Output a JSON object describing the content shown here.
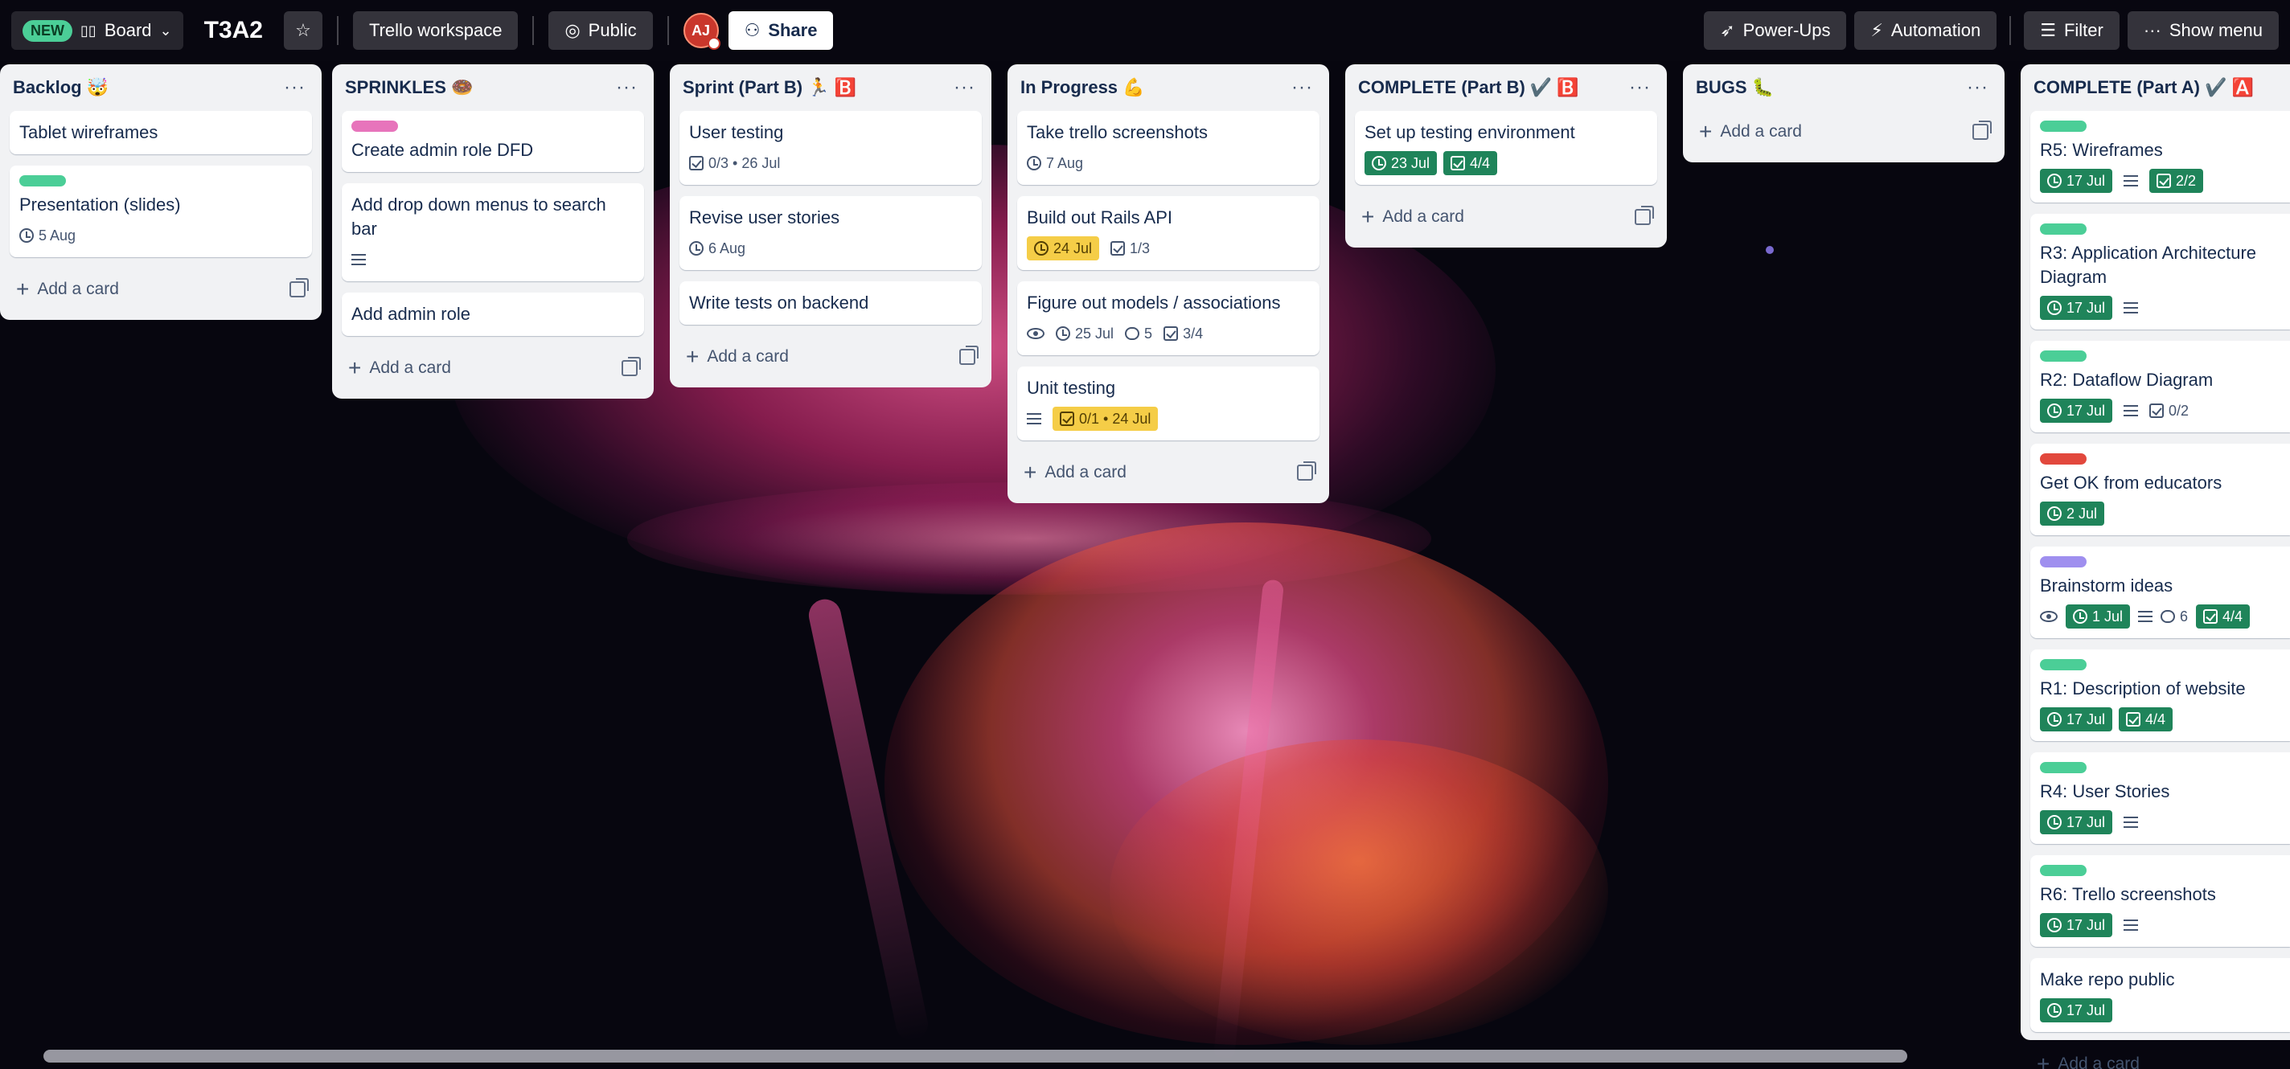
{
  "header": {
    "new_badge": "NEW",
    "board_view": "Board",
    "board_title": "T3A2",
    "workspace": "Trello workspace",
    "visibility": "Public",
    "avatar_initials": "AJ",
    "share": "Share",
    "power_ups": "Power-Ups",
    "automation": "Automation",
    "filter": "Filter",
    "show_menu": "Show menu"
  },
  "lists": [
    {
      "title": "Backlog 🤯",
      "add_label": "Add a card",
      "cards": [
        {
          "title": "Tablet wireframes"
        },
        {
          "title": "Presentation (slides)",
          "label_color": "#4bce97",
          "date": "5 Aug"
        }
      ]
    },
    {
      "title": "SPRINKLES 🍩",
      "add_label": "Add a card",
      "cards": [
        {
          "title": "Create admin role DFD",
          "label_color": "#e774bb"
        },
        {
          "title": "Add drop down menus to search bar",
          "description": true
        },
        {
          "title": "Add admin role"
        }
      ]
    },
    {
      "title": "Sprint (Part B) 🏃 🅱️",
      "add_label": "Add a card",
      "cards": [
        {
          "title": "User testing",
          "checklist": "0/3 • 26 Jul"
        },
        {
          "title": "Revise user stories",
          "date": "6 Aug"
        },
        {
          "title": "Write tests on backend"
        }
      ]
    },
    {
      "title": "In Progress 💪",
      "add_label": "Add a card",
      "cards": [
        {
          "title": "Take trello screenshots",
          "date": "7 Aug"
        },
        {
          "title": "Build out Rails API",
          "date_yellow": "24 Jul",
          "checklist": "1/3"
        },
        {
          "title": "Figure out models / associations",
          "date": "25 Jul",
          "comments": "5",
          "checklist": "3/4"
        },
        {
          "title": "Unit testing",
          "checklist_yellow": "0/1 • 24 Jul"
        }
      ]
    },
    {
      "title": "COMPLETE (Part B) ✔️ 🅱️",
      "add_label": "Add a card",
      "cards": [
        {
          "title": "Set up testing environment",
          "date_green": "23 Jul",
          "checklist_green": "4/4"
        }
      ]
    },
    {
      "title": "BUGS 🐛",
      "add_label": "Add a card",
      "cards": []
    },
    {
      "title": "COMPLETE (Part A) ✔️ 🅰️",
      "add_label": "Add a card",
      "cards": [
        {
          "title": "R5: Wireframes",
          "label_color": "#4bce97",
          "date_green": "17 Jul",
          "checklist_green": "2/2"
        },
        {
          "title": "R3: Application Architecture Diagram",
          "label_color": "#4bce97",
          "date_green": "17 Jul"
        },
        {
          "title": "R2: Dataflow Diagram",
          "label_color": "#4bce97",
          "date_green": "17 Jul",
          "checklist": "0/2"
        },
        {
          "title": "Get OK from educators",
          "label_color": "#e2483d",
          "date_green": "2 Jul"
        },
        {
          "title": "Brainstorm ideas",
          "label_color": "#9f8fef",
          "date_green": "1 Jul",
          "comments": "6",
          "checklist_green": "4/4"
        },
        {
          "title": "R1: Description of website",
          "label_color": "#4bce97",
          "date_green": "17 Jul",
          "checklist_green": "4/4"
        },
        {
          "title": "R4: User Stories",
          "label_color": "#4bce97",
          "date_green": "17 Jul"
        },
        {
          "title": "R6: Trello screenshots",
          "label_color": "#4bce97",
          "date_green": "17 Jul"
        },
        {
          "title": "Make repo public",
          "date_green": "17 Jul"
        }
      ]
    }
  ],
  "colors": {
    "label_green": "#4bce97",
    "label_pink": "#e774bb",
    "label_red": "#e2483d",
    "label_purple": "#9f8fef",
    "badge_green": "#1f845a",
    "badge_yellow": "#f5cd47"
  }
}
